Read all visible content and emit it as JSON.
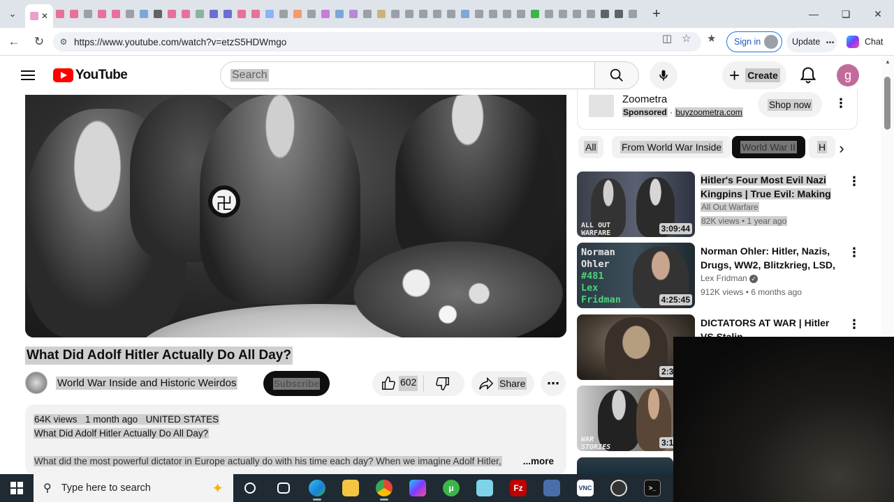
{
  "browser": {
    "url": "https://www.youtube.com/watch?v=etzS5HDWmgo",
    "signin_label": "Sign in",
    "update_label": "Update",
    "chat_label": "Chat",
    "tab_favicon_colors": [
      "#e8a3c7",
      "#e8709a",
      "#e8709a",
      "#9aa0a6",
      "#e8709a",
      "#e8709a",
      "#9aa0a6",
      "#7da7d9",
      "#5f6368",
      "#e8709a",
      "#e8709a",
      "#8ab4a0",
      "#6b6fd1",
      "#6b6fd1",
      "#e8709a",
      "#e8709a",
      "#8ab4f8",
      "#9aa0a6",
      "#f29b6b",
      "#9aa0a6",
      "#c77dd4",
      "#7da7d9",
      "#b58ad6",
      "#9aa0a6",
      "#c8b47d",
      "#9aa0a6",
      "#9aa0a6",
      "#9aa0a6",
      "#9aa0a6",
      "#9aa0a6",
      "#7da7d9",
      "#9aa0a6",
      "#9aa0a6",
      "#9aa0a6",
      "#9aa0a6",
      "#3bb54a",
      "#9aa0a6",
      "#9aa0a6",
      "#9aa0a6",
      "#9aa0a6",
      "#5f6368",
      "#5f6368",
      "#9aa0a6"
    ]
  },
  "youtube": {
    "logo_text": "YouTube",
    "search_placeholder": "Search",
    "create_label": "Create",
    "user_initial": "g"
  },
  "video": {
    "title": "What Did Adolf Hitler Actually Do All Day?",
    "channel": "World War Inside and Historic Weirdos",
    "subscribe_label": "Subscribe",
    "likes": "602",
    "share_label": "Share",
    "views": "64K views",
    "age": "1 month ago",
    "country": "UNITED STATES",
    "desc_title": "What Did Adolf Hitler Actually Do All Day?",
    "desc_snippet": "What did the most powerful dictator in Europe actually do with his time each day? When we imagine Adolf Hitler,",
    "more_label": "...more"
  },
  "ad": {
    "name": "Zoometra",
    "sponsored": "Sponsored",
    "domain": "buyzoometra.com",
    "cta": "Shop now"
  },
  "chips": [
    "All",
    "From World War Inside",
    "World War II",
    "H"
  ],
  "recommendations": [
    {
      "title": "Hitler's Four Most Evil Nazi Kingpins | True Evil: Making Of...",
      "channel": "All Out Warfare",
      "meta": "82K views • 1 year ago",
      "duration": "3:09:44",
      "thumb_text": "ALL OUT WARFARE"
    },
    {
      "title": "Norman Ohler: Hitler, Nazis, Drugs, WW2, Blitzkrieg, LSD, ...",
      "channel": "Lex Fridman",
      "meta": "912K views • 6 months ago",
      "duration": "4:25:45",
      "thumb_text": [
        "Norman",
        "Ohler",
        "#481",
        "Lex",
        "Fridman"
      ]
    },
    {
      "title": "DICTATORS AT WAR | Hitler VS Stalin",
      "channel": "",
      "meta": "",
      "duration": "2:3",
      "thumb_text": ""
    },
    {
      "title": "",
      "channel": "",
      "meta": "",
      "duration": "3:1",
      "thumb_text": "WAR STORIES"
    }
  ],
  "taskbar": {
    "search_placeholder": "Type here to search",
    "apps": [
      "task-view",
      "edge",
      "file-explorer",
      "chrome",
      "copilot",
      "utorrent",
      "notepad",
      "filezilla",
      "network",
      "vnc",
      "recorder",
      "terminal"
    ]
  }
}
